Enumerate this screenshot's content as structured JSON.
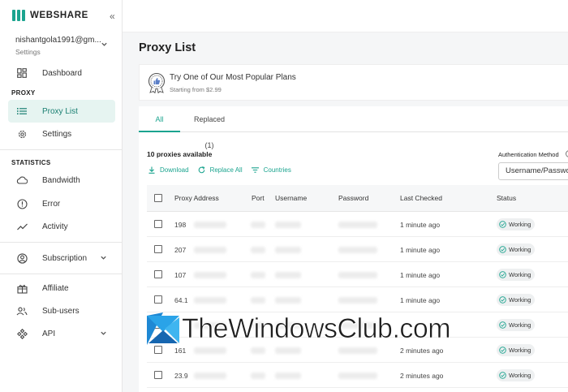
{
  "brand": {
    "name": "WEBSHARE",
    "accent": "#1ba48f"
  },
  "sidebar": {
    "collapse_icon": "«",
    "account": {
      "email": "nishantgola1991@gm...",
      "sub": "Settings"
    },
    "items": {
      "dashboard": "Dashboard",
      "proxy_list": "Proxy List",
      "settings": "Settings",
      "bandwidth": "Bandwidth",
      "error": "Error",
      "activity": "Activity",
      "subscription": "Subscription",
      "affiliate": "Affiliate",
      "sub_users": "Sub-users",
      "api": "API"
    },
    "sections": {
      "proxy": "PROXY",
      "statistics": "STATISTICS"
    }
  },
  "main": {
    "title": "Proxy List",
    "promo": {
      "title": "Try One of Our Most Popular Plans",
      "subtitle": "Starting from $2.99"
    },
    "tabs": {
      "all": "All",
      "replaced": "Replaced (1)"
    },
    "available": "10 proxies available",
    "actions": {
      "download": "Download",
      "replace_all": "Replace All",
      "countries": "Countries"
    },
    "auth": {
      "label": "Authentication Method",
      "value": "Username/Password"
    },
    "columns": {
      "proxy_address": "Proxy Address",
      "port": "Port",
      "username": "Username",
      "password": "Password",
      "last_checked": "Last Checked",
      "status": "Status"
    },
    "rows": [
      {
        "address": "198",
        "last_checked": "1 minute ago",
        "status": "Working"
      },
      {
        "address": "207",
        "last_checked": "1 minute ago",
        "status": "Working"
      },
      {
        "address": "107",
        "last_checked": "1 minute ago",
        "status": "Working"
      },
      {
        "address": "64.1",
        "last_checked": "1 minute ago",
        "status": "Working"
      },
      {
        "address": "",
        "last_checked": "",
        "status": "Working"
      },
      {
        "address": "161",
        "last_checked": "2 minutes ago",
        "status": "Working"
      },
      {
        "address": "23.9",
        "last_checked": "2 minutes ago",
        "status": "Working"
      }
    ]
  },
  "watermark": {
    "text": "TheWindowsClub.com"
  }
}
